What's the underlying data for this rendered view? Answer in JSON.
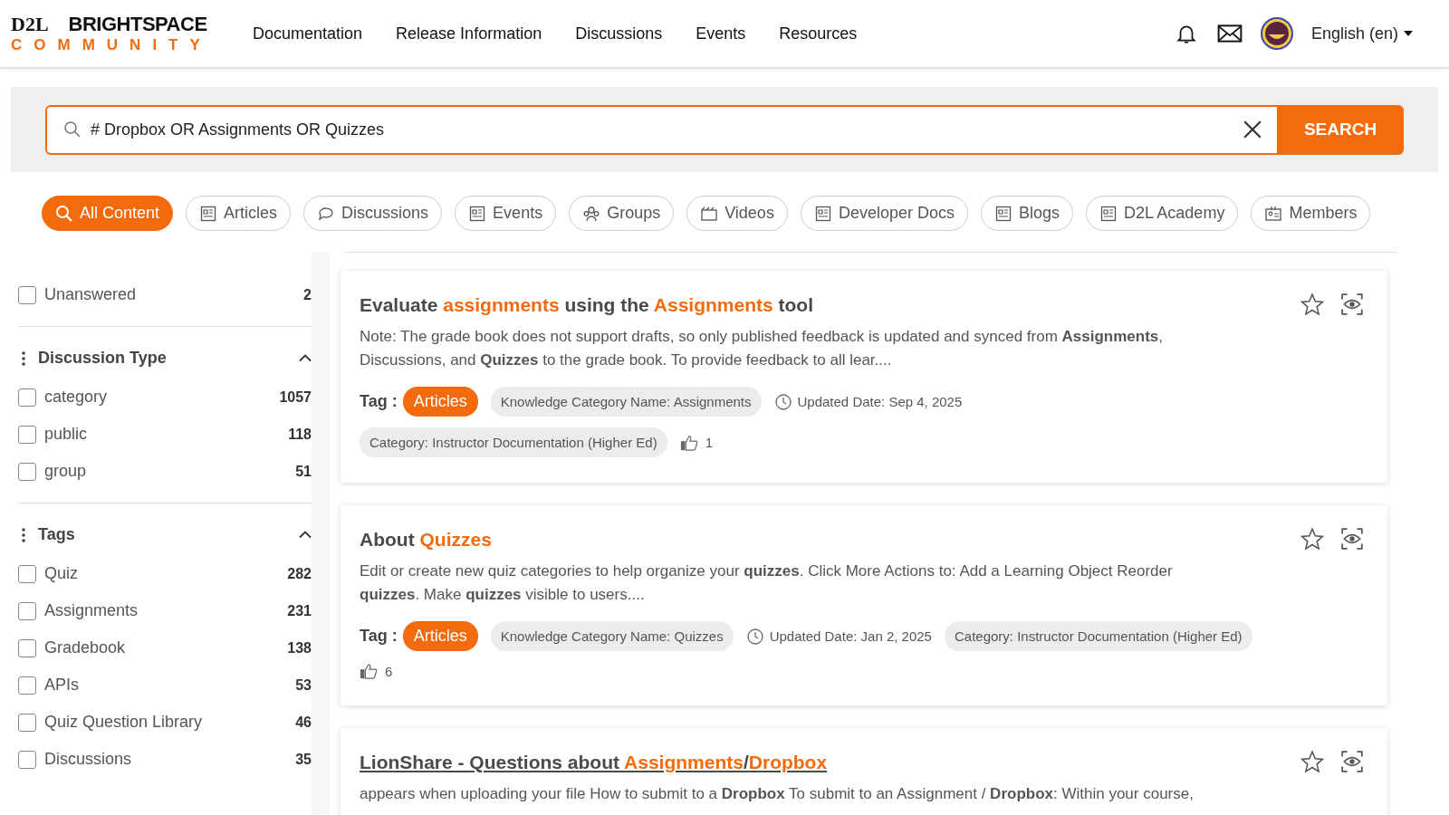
{
  "header": {
    "logo": {
      "brand": "D2L",
      "product": "BRIGHTSPACE",
      "subtitle": "COMMUNITY"
    },
    "nav": [
      "Documentation",
      "Release Information",
      "Discussions",
      "Events",
      "Resources"
    ],
    "language": "English (en)"
  },
  "search": {
    "value": "# Dropbox OR Assignments OR Quizzes",
    "button": "SEARCH"
  },
  "filters": [
    {
      "label": "All Content",
      "selected": true
    },
    {
      "label": "Articles",
      "selected": false
    },
    {
      "label": "Discussions",
      "selected": false
    },
    {
      "label": "Events",
      "selected": false
    },
    {
      "label": "Groups",
      "selected": false
    },
    {
      "label": "Videos",
      "selected": false
    },
    {
      "label": "Developer Docs",
      "selected": false
    },
    {
      "label": "Blogs",
      "selected": false
    },
    {
      "label": "D2L Academy",
      "selected": false
    },
    {
      "label": "Members",
      "selected": false
    }
  ],
  "sidebar": {
    "sections": [
      {
        "options": [
          {
            "label": "Unanswered",
            "count": "2",
            "checked": false
          }
        ]
      },
      {
        "title": "Discussion Type",
        "expanded": true,
        "options": [
          {
            "label": "category",
            "count": "1057",
            "checked": false
          },
          {
            "label": "public",
            "count": "118",
            "checked": false
          },
          {
            "label": "group",
            "count": "51",
            "checked": false
          }
        ]
      },
      {
        "title": "Tags",
        "expanded": true,
        "options": [
          {
            "label": "Quiz",
            "count": "282",
            "checked": false
          },
          {
            "label": "Assignments",
            "count": "231",
            "checked": false
          },
          {
            "label": "Gradebook",
            "count": "138",
            "checked": false
          },
          {
            "label": "APIs",
            "count": "53",
            "checked": false
          },
          {
            "label": "Quiz Question Library",
            "count": "46",
            "checked": false
          },
          {
            "label": "Discussions",
            "count": "35",
            "checked": false
          }
        ]
      }
    ]
  },
  "results": [
    {
      "link": false,
      "title": [
        {
          "text": "Evaluate ",
          "highlight": false
        },
        {
          "text": "assignments",
          "highlight": true
        },
        {
          "text": " using the ",
          "highlight": false
        },
        {
          "text": "Assignments",
          "highlight": true
        },
        {
          "text": " tool",
          "highlight": false
        }
      ],
      "snippet": "Note: The grade book does not support drafts, so only published feedback is updated and synced from **Assignments**, Discussions, and **Quizzes** to the grade book. To provide feedback to all lear....",
      "meta": [
        {
          "kind": "tag_label",
          "text": "Tag :"
        },
        {
          "kind": "tag",
          "text": "Articles"
        },
        {
          "kind": "chip",
          "text": "Knowledge Category Name: Assignments"
        },
        {
          "kind": "date",
          "text": "Updated Date: Sep 4, 2025"
        },
        {
          "kind": "chip",
          "text": "Category: Instructor Documentation (Higher Ed)"
        },
        {
          "kind": "likes",
          "text": "1"
        }
      ]
    },
    {
      "link": false,
      "title": [
        {
          "text": "About ",
          "highlight": false
        },
        {
          "text": "Quizzes",
          "highlight": true
        }
      ],
      "snippet": "Edit or create new quiz categories to help organize your **quizzes**. Click More Actions to: Add a Learning Object Reorder **quizzes**. Make **quizzes** visible to users....",
      "meta": [
        {
          "kind": "tag_label",
          "text": "Tag :"
        },
        {
          "kind": "tag",
          "text": "Articles"
        },
        {
          "kind": "chip",
          "text": "Knowledge Category Name: Quizzes"
        },
        {
          "kind": "date",
          "text": "Updated Date: Jan 2, 2025"
        },
        {
          "kind": "chip",
          "text": "Category: Instructor Documentation (Higher Ed)"
        },
        {
          "kind": "likes",
          "text": "6"
        }
      ]
    },
    {
      "link": true,
      "title": [
        {
          "text": "LionShare - Questions about ",
          "highlight": false
        },
        {
          "text": "Assignments",
          "highlight": true
        },
        {
          "text": "/",
          "highlight": false
        },
        {
          "text": "Dropbox",
          "highlight": true
        }
      ],
      "snippet": "appears when uploading your file How to submit to a **Dropbox** To submit to an Assignment / **Dropbox**: Within your course,"
    }
  ]
}
